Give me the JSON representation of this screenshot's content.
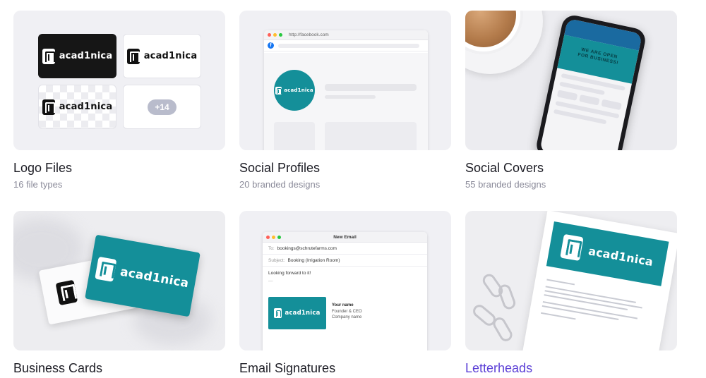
{
  "cards": [
    {
      "title": "Logo Files",
      "subtitle": "16 file types"
    },
    {
      "title": "Social Profiles",
      "subtitle": "20 branded designs"
    },
    {
      "title": "Social Covers",
      "subtitle": "55 branded designs"
    },
    {
      "title": "Business Cards",
      "subtitle": ""
    },
    {
      "title": "Email Signatures",
      "subtitle": ""
    },
    {
      "title": "Letterheads",
      "subtitle": ""
    }
  ],
  "brand": {
    "name": "acad1nica",
    "teal": "#148f99",
    "accent": "#5b3fd6"
  },
  "logo_files": {
    "more_count": "+14"
  },
  "social_profiles": {
    "url": "http://facebook.com",
    "fb_glyph": "f"
  },
  "social_covers": {
    "cover_text_1": "WE ARE OPEN",
    "cover_text_2": "FOR BUSINESS!"
  },
  "email": {
    "window_title": "New Email",
    "to_label": "To:",
    "to_value": "bookings@schrutefarms.com",
    "subject_label": "Subject:",
    "subject_value": "Booking (Irrigation Room)",
    "body": "Looking forward to it!",
    "separator": "—",
    "sig_name": "Your name",
    "sig_role": "Founder & CEO",
    "sig_company": "Company name"
  },
  "icons": {
    "logo_mark": "acad1nica-logo-icon",
    "facebook": "facebook-icon"
  }
}
